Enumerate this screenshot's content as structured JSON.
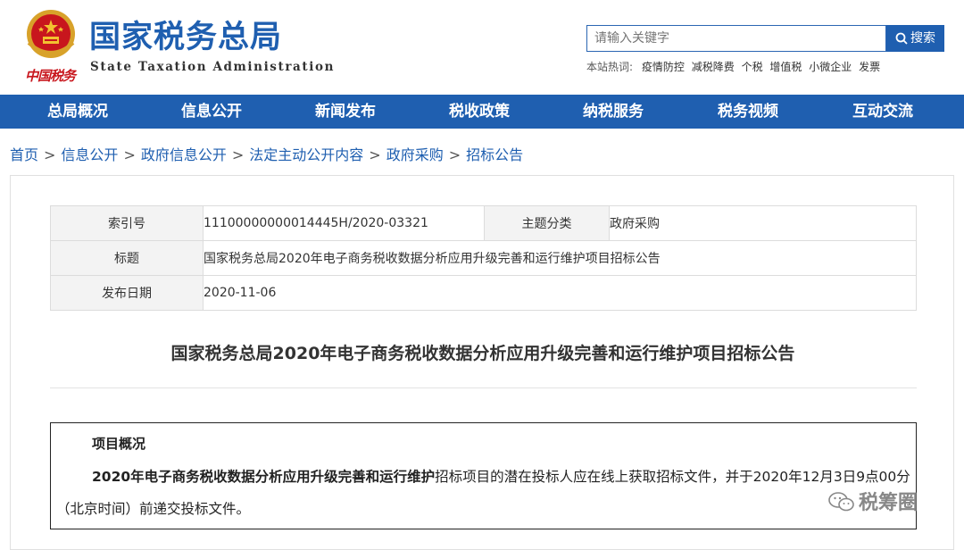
{
  "header": {
    "title_cn": "国家税务总局",
    "title_en": "State Taxation Administration",
    "calligraphy": "中国税务",
    "search_placeholder": "请输入关键字",
    "search_button": "搜索",
    "hot_label": "本站热词:",
    "hot_words": [
      "疫情防控",
      "减税降费",
      "个税",
      "增值税",
      "小微企业",
      "发票"
    ]
  },
  "nav": {
    "items": [
      "总局概况",
      "信息公开",
      "新闻发布",
      "税收政策",
      "纳税服务",
      "税务视频",
      "互动交流"
    ]
  },
  "breadcrumb": [
    "首页",
    "信息公开",
    "政府信息公开",
    "法定主动公开内容",
    "政府采购",
    "招标公告"
  ],
  "meta": {
    "index_label": "索引号",
    "index_value": "11100000000014445H/2020-03321",
    "topic_label": "主题分类",
    "topic_value": "政府采购",
    "title_label": "标题",
    "title_value": "国家税务总局2020年电子商务税收数据分析应用升级完善和运行维护项目招标公告",
    "date_label": "发布日期",
    "date_value": "2020-11-06"
  },
  "article": {
    "title": "国家税务总局2020年电子商务税收数据分析应用升级完善和运行维护项目招标公告",
    "section_head": "项目概况",
    "para_bold": "2020年电子商务税收数据分析应用升级完善和运行维护",
    "para_rest": "招标项目的潜在投标人应在线上获取招标文件，并于2020年12月3日9点00分（北京时间）前递交投标文件。"
  },
  "watermark": "税筹圈",
  "colors": {
    "brand_blue": "#1f5fb0",
    "emblem_red": "#c8161d"
  }
}
